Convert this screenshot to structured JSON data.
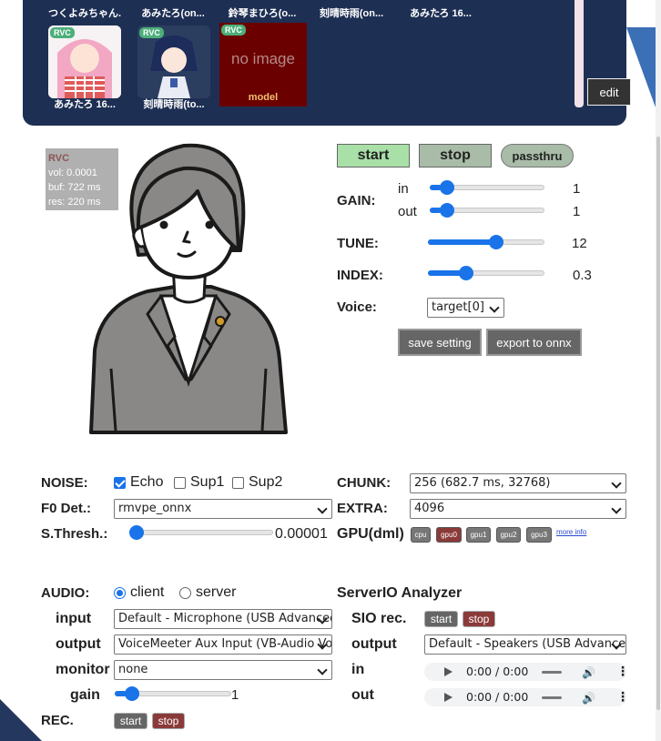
{
  "gallery": {
    "top_row_names": [
      "つくよみちゃん...",
      "あみたろ(on...",
      "鈴琴まひろ(o...",
      "刻晴時雨(on...",
      "あみたろ 16..."
    ],
    "tiles": [
      {
        "badge": "RVC",
        "name": "あみたろ 16..."
      },
      {
        "badge": "RVC",
        "name": "刻晴時雨(to..."
      },
      {
        "badge": "RVC",
        "noimage": "no image",
        "name": "model"
      }
    ],
    "edit_label": "edit"
  },
  "status": {
    "type": "RVC",
    "vol": "vol: 0.0001",
    "buf": "buf: 722 ms",
    "res": "res: 220 ms"
  },
  "controls": {
    "start_label": "start",
    "stop_label": "stop",
    "passthru_label": "passthru",
    "gain_label": "GAIN:",
    "gain_in_label": "in",
    "gain_out_label": "out",
    "gain_in_value": "1",
    "gain_out_value": "1",
    "gain_in_level": 0.1,
    "gain_out_level": 0.1,
    "tune_label": "TUNE:",
    "tune_value": "12",
    "tune_level": 0.6,
    "index_label": "INDEX:",
    "index_value": "0.3",
    "index_level": 0.3,
    "voice_label": "Voice:",
    "voice_value": "target[0]",
    "save_setting_label": "save setting",
    "export_onnx_label": "export to onnx"
  },
  "settings": {
    "noise_label": "NOISE:",
    "echo_label": "Echo",
    "sup1_label": "Sup1",
    "sup2_label": "Sup2",
    "echo_checked": true,
    "f0_label": "F0 Det.:",
    "f0_value": "rmvpe_onnx",
    "sthresh_label": "S.Thresh.:",
    "sthresh_value": "0.00001",
    "sthresh_level": 0.0,
    "chunk_label": "CHUNK:",
    "chunk_value": "256 (682.7 ms, 32768)",
    "extra_label": "EXTRA:",
    "extra_value": "4096",
    "gpu_label": "GPU(dml)",
    "gpu_options": [
      "cpu",
      "gpu0",
      "gpu1",
      "gpu2",
      "gpu3"
    ],
    "gpu_selected": "gpu0",
    "more_info_label": "more info"
  },
  "audio": {
    "audio_label": "AUDIO:",
    "client_label": "client",
    "server_label": "server",
    "input_label": "input",
    "input_value": "Default - Microphone (USB Advanced Audio Device)",
    "output_label": "output",
    "output_value": "VoiceMeeter Aux Input (VB-Audio VoiceMeeter AUX VAIO)",
    "monitor_label": "monitor",
    "monitor_value": "none",
    "gain_label": "gain",
    "gain_value": "1",
    "gain_level": 0.1,
    "rec_label": "REC.",
    "rec_start": "start",
    "rec_stop": "stop"
  },
  "serverio": {
    "title": "ServerIO Analyzer",
    "sio_rec_label": "SIO rec.",
    "start": "start",
    "stop": "stop",
    "output_label": "output",
    "output_value": "Default - Speakers (USB Advanced Audio Device)",
    "in_label": "in",
    "out_label": "out",
    "in_time": "0:00 / 0:00",
    "out_time": "0:00 / 0:00"
  }
}
